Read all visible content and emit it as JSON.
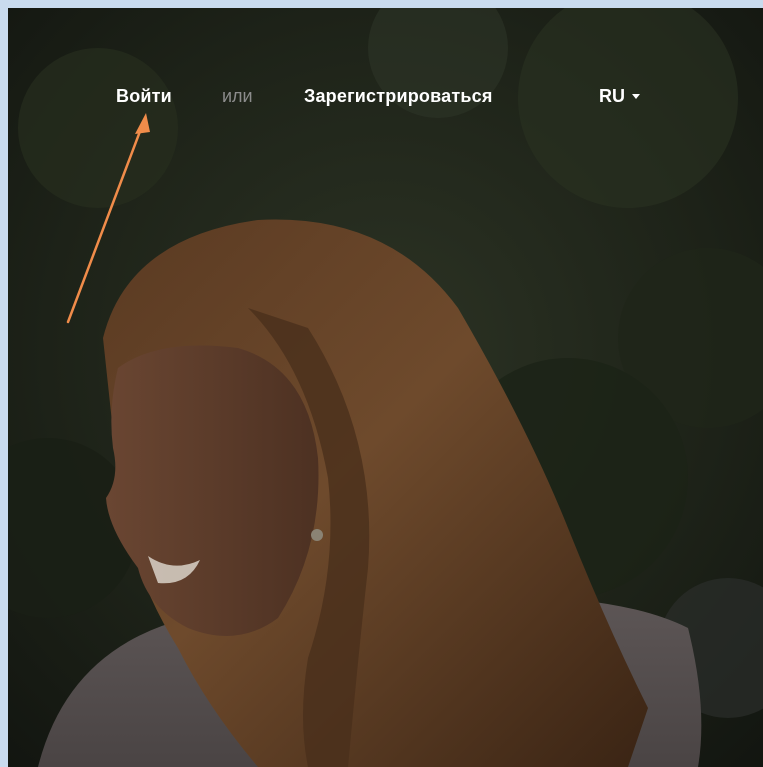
{
  "nav": {
    "login_label": "Войти",
    "separator": "или",
    "register_label": "Зарегистрироваться",
    "language_label": "RU"
  },
  "colors": {
    "annotation_arrow": "#f08c4a",
    "nav_text": "#ffffff",
    "nav_separator": "#8c8c8c",
    "frame_border": "#c9dbee"
  },
  "icons": {
    "language_caret": "chevron-down-icon"
  }
}
